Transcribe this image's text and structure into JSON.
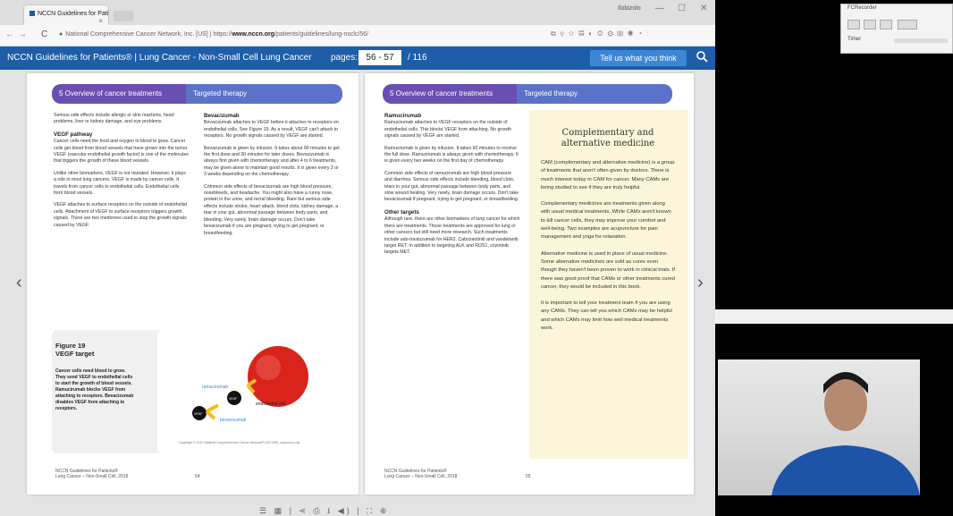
{
  "browser": {
    "tab_title": "NCCN Guidelines for Pati",
    "tab_close": "×",
    "window_user": "Ilobizolo",
    "window_buttons": [
      "—",
      "☐",
      "✕"
    ],
    "nav": {
      "back": "←",
      "forward": "→",
      "reload": "C"
    },
    "url_prefix": "National Comprehensive Cancer Network, Inc. [US] | https://",
    "url_domain": "www.nccn.org",
    "url_path": "/patients/guidelines/lung-nsclc/56/"
  },
  "header": {
    "title": "NCCN Guidelines for Patients® | Lung Cancer - Non-Small Cell Lung Cancer",
    "pages_label": "pages:",
    "pages_value": "56 - 57",
    "pages_total": "/ 116",
    "feedback_button": "Tell us what you think",
    "search_icon": "search-icon"
  },
  "left_page": {
    "section_number": "5   Overview of cancer treatments",
    "section_topic": "Targeted therapy",
    "col1": {
      "intro": "Serious side effects include allergic or skin reactions, heart problems, liver or kidney damage, and eye problems.",
      "heading": "VEGF pathway",
      "p1": "Cancer cells need the food and oxygen in blood to grow. Cancer cells get blood from blood vessels that have grown into the tumor. VEGF (vascular endothelial growth factor) is one of the molecules that triggers the growth of these blood vessels.",
      "p2": "Unlike other biomarkers, VEGF is not mutated. However, it plays a role in most lung cancers. VEGF is made by cancer cells. It travels from cancer cells to endothelial cells. Endothelial cells form blood vessels.",
      "p3": "VEGF attaches to surface receptors on the outside of endothelial cells. Attachment of VEGF to surface receptors triggers growth signals. There are two medicines used to stop the growth signals caused by VEGF."
    },
    "col2": {
      "heading": "Bevacizumab",
      "p1": "Bevacizumab attaches to VEGF before it attaches to receptors on endothelial cells. See Figure 19. As a result, VEGF can't attach to receptors. No growth signals caused by VEGF are started.",
      "p2": "Bevacizumab is given by infusion. It takes about 90 minutes to get the first dose and 30 minutes for later doses. Bevacizumab is always first given with chemotherapy and after 4 to 6 treatments, may be given alone to maintain good results. It is given every 2 or 3 weeks depending on the chemotherapy.",
      "p3": "Common side effects of bevacizumab are high blood pressure, nosebleeds, and headache. You might also have a runny nose, protein in the urine, and rectal bleeding. Rare but serious side effects include stroke, heart attack, blood clots, kidney damage, a tear in your gut, abnormal passage between body parts, and bleeding. Very rarely, brain damage occurs. Don't take bevacizumab if you are pregnant, trying to get pregnant, or breastfeeding."
    },
    "figure": {
      "title": "Figure 19\nVEGF target",
      "caption": "Cancer cells need blood to grow. They send VEGF to endothelial cells to start the growth of blood vessels. Ramucirumab blocks VEGF from attaching to receptors. Bevacizumab disables VEGF from attaching to receptors.",
      "label_ramucirumab": "ramucirumab",
      "label_vegf1": "VEGF",
      "label_vegf2": "VEGF",
      "label_endothelial": "endothelial cell",
      "label_bevacizumab": "bevacizumab",
      "copyright": "Copyright © 2017 National Comprehensive Cancer Network® (NCCN®). www.nccn.org"
    },
    "footer_line1": "NCCN Guidelines for Patients®",
    "footer_line2": "Lung Cancer – Non-Small Cell, 2018",
    "page_number": "54"
  },
  "right_page": {
    "section_number": "5   Overview of cancer treatments",
    "section_topic": "Targeted therapy",
    "col1": {
      "heading": "Ramucirumab",
      "p1": "Ramucirumab attaches to VEGF receptors on the outside of endothelial cells. This blocks VEGF from attaching. No growth signals caused by VEGF are started.",
      "p2": "Ramucirumab is given by infusion. It takes 60 minutes to receive the full dose. Ramucirumab is always given with chemotherapy. It is given every two weeks on the first day of chemotherapy.",
      "p3": "Common side effects of ramucirumab are high blood pressure and diarrhea. Serious side effects include bleeding, blood clots, tears in your gut, abnormal passage between body parts, and slow wound healing. Very rarely, brain damage occurs. Don't take bevacizumab if pregnant, trying to get pregnant, or breastfeeding.",
      "heading2": "Other targets",
      "p4": "Although rare, there are other biomarkers of lung cancer for which there are treatments. Those treatments are approved for lung or other cancers but still need more research. Such treatments include ado-trastuzumab for HER2. Cabozantinib and vandetanib target RET. In addition to targeting ALK and ROS1, crizotinib targets MET."
    },
    "cam": {
      "title": "Complementary and alternative medicine",
      "p1": "CAM (complementary and alternative medicine) is a group of treatments that aren't often given by doctors. There is much interest today in CAM for cancer. Many CAMs are being studied to see if they are truly helpful.",
      "p2": "Complementary medicines are treatments given along with usual medical treatments. While CAMs aren't known to kill cancer cells, they may improve your comfort and well-being. Two examples are acupuncture for pain management and yoga for relaxation.",
      "p3": "Alternative medicine is used in place of usual medicine. Some alternative medicines are sold as cures even though they haven't been proven to work in clinical trials. If there was good proof that CAMs or other treatments cured cancer, they would be included in this book.",
      "p4": "It is important to tell your treatment team if you are using any CAMs. They can tell you which CAMs may be helpful and which CAMs may limit how well medical treatments work."
    },
    "footer_line1": "NCCN Guidelines for Patients®",
    "footer_line2": "Lung Cancer – Non-Small Cell, 2018",
    "page_number": "55"
  },
  "viewer_nav": {
    "prev": "‹",
    "next": "›"
  },
  "bottom_toolbar": "☰ ▦ | ⋖ ⎙ ⭳ ◀) | ⛶ ⊕",
  "recorder": {
    "title": "FCRecorder",
    "timer_label": "Timer"
  },
  "colors": {
    "nccn_blue": "#1e5ea8",
    "section_purple": "#6a4fb3",
    "section_blue": "#5b72c8",
    "cam_yellow": "#fbf6d9"
  }
}
